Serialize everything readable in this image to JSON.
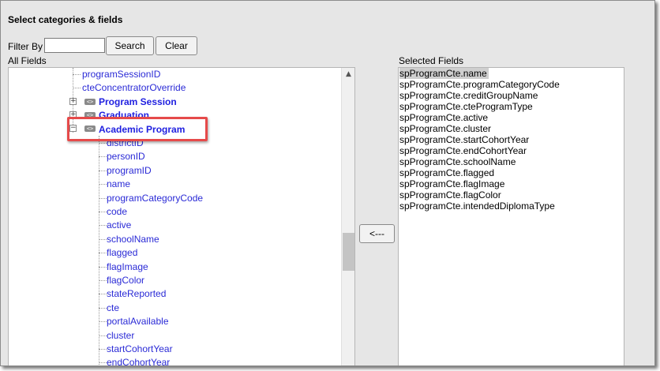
{
  "title": "Select categories & fields",
  "filter": {
    "label": "Filter By",
    "value": "",
    "search_label": "Search",
    "clear_label": "Clear"
  },
  "all_fields_label": "All Fields",
  "selected_fields_label": "Selected Fields",
  "remove_button_label": "<---",
  "tree": {
    "top_items": [
      "programSessionID",
      "cteConcentratorOverride"
    ],
    "categories": [
      {
        "name": "Program Session",
        "state": "collapsed"
      },
      {
        "name": "Graduation",
        "state": "collapsed"
      },
      {
        "name": "Academic Program",
        "state": "expanded"
      }
    ],
    "academic_program_fields": [
      "districtID",
      "personID",
      "programID",
      "name",
      "programCategoryCode",
      "code",
      "active",
      "schoolName",
      "flagged",
      "flagImage",
      "flagColor",
      "stateReported",
      "cte",
      "portalAvailable",
      "cluster",
      "startCohortYear",
      "endCohortYear"
    ]
  },
  "selected_fields": [
    "spProgramCte.name",
    "spProgramCte.programCategoryCode",
    "spProgramCte.creditGroupName",
    "spProgramCte.cteProgramType",
    "spProgramCte.active",
    "spProgramCte.cluster",
    "spProgramCte.startCohortYear",
    "spProgramCte.endCohortYear",
    "spProgramCte.schoolName",
    "spProgramCte.flagged",
    "spProgramCte.flagImage",
    "spProgramCte.flagColor",
    "spProgramCte.intendedDiplomaType"
  ],
  "selected_index": 0,
  "colors": {
    "highlight": "#e64a4a",
    "link": "#2a2ad6",
    "panel_bg": "#e6e6e6"
  },
  "icons": {
    "expand": "plus-box-icon",
    "collapse": "minus-box-icon",
    "category": "category-icon",
    "scroll_up": "scroll-up-arrow-icon",
    "scroll_down": "scroll-down-arrow-icon"
  }
}
